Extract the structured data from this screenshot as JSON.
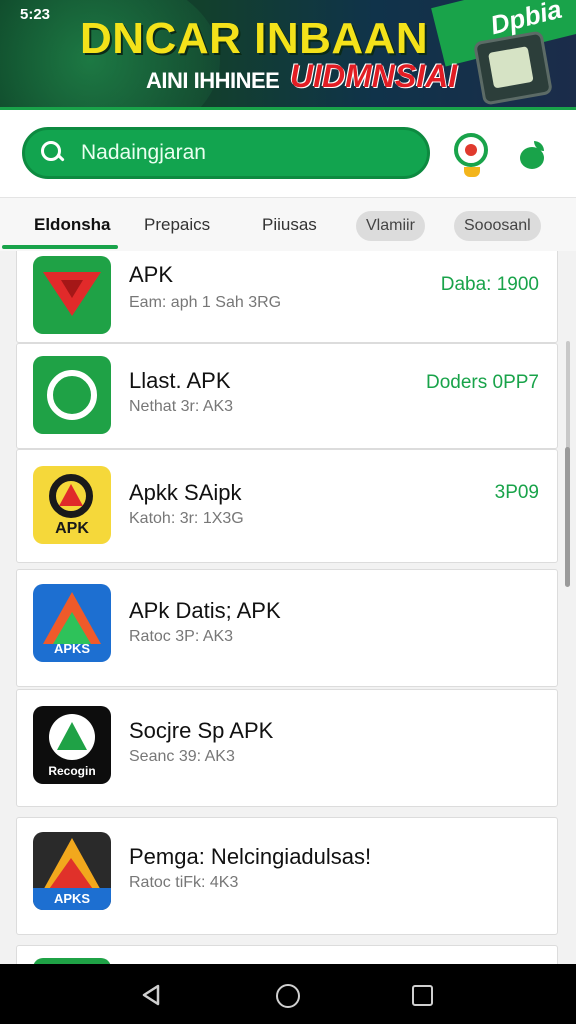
{
  "status": {
    "time": "5:23"
  },
  "banner": {
    "title": "DNCAR INBAAN",
    "sub1": "AINI IHHINEE",
    "sub2": "UIDMNSIAI",
    "corner": "Dpbia"
  },
  "search": {
    "placeholder": "Nadaingjaran"
  },
  "tabs": [
    {
      "label": "Eldonsha"
    },
    {
      "label": "Prepaics"
    },
    {
      "label": "Piiusas"
    },
    {
      "label": "Vlamiir"
    },
    {
      "label": "Sooosanl"
    }
  ],
  "apps": [
    {
      "title": "APK",
      "meta": "Eam: aph 1 Sah 3RG",
      "price": "Daba: 1900",
      "icon": "red-triangle-app-icon"
    },
    {
      "title": "Llast. APK",
      "meta": "Nethat 3r: AK3",
      "price": "Doders 0PP7",
      "icon": "green-a-app-icon"
    },
    {
      "title": "Apkk SAipk",
      "meta": "Katoh: 3r: 1X3G",
      "price": "3P09",
      "icon": "yellow-apk-app-icon"
    },
    {
      "title": "APk Datis; APK",
      "meta": "Ratoc 3P: AK3",
      "price": "",
      "icon": "blue-apk-app-icon",
      "icon_text": "APKS"
    },
    {
      "title": "Socjre Sp APK",
      "meta": "Seanc 39: AK3",
      "price": "",
      "icon": "black-recogin-app-icon",
      "icon_text": "Recogin"
    },
    {
      "title": "Pemga: Nelcingiadulsas!",
      "meta": "Ratoc tiFk: 4K3",
      "price": "",
      "icon": "multicolor-apk-app-icon",
      "icon_text": "APKS"
    }
  ],
  "yellow_icon_text": "APK",
  "colors": {
    "accent": "#19a34a",
    "price": "#19a34a",
    "banner_title": "#f4e21a",
    "banner_red": "#e21d24"
  }
}
